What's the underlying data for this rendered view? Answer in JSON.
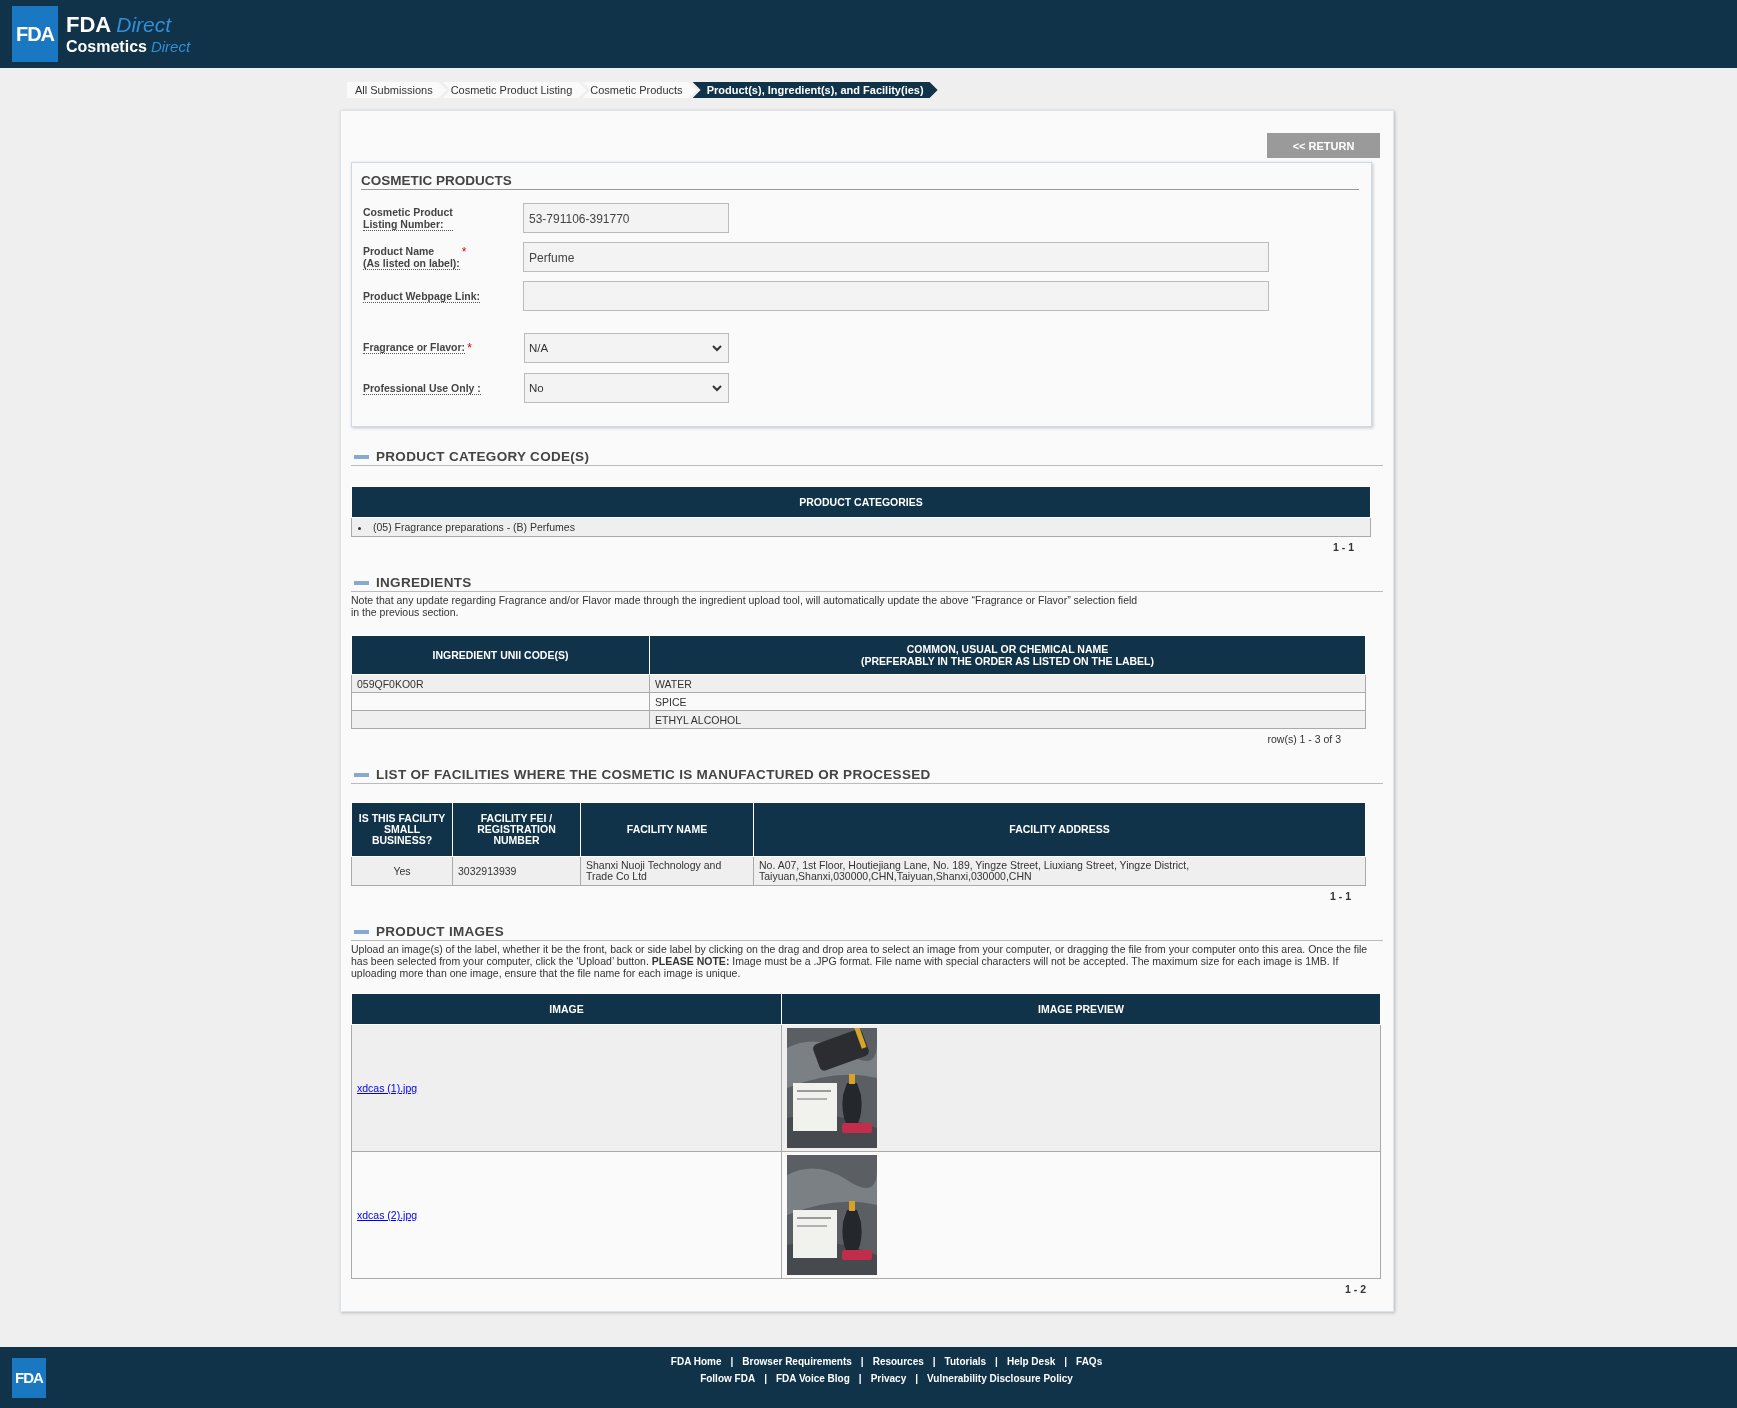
{
  "header": {
    "logo_badge": "FDA",
    "logo_title": "FDA",
    "logo_title_accent": "Direct",
    "logo_subtitle": "Cosmetics",
    "logo_subtitle_accent": "Direct"
  },
  "breadcrumb": [
    {
      "label": "All Submissions",
      "selected": false
    },
    {
      "label": "Cosmetic Product Listing",
      "selected": false
    },
    {
      "label": "Cosmetic Products",
      "selected": false
    },
    {
      "label": "Product(s), Ingredient(s), and Facility(ies)",
      "selected": true
    }
  ],
  "return_button": "<< RETURN",
  "cosmetic_products": {
    "title": "COSMETIC PRODUCTS",
    "fields": [
      {
        "kind": "text",
        "label": "Cosmetic Product\nListing Number:",
        "value": "53-791106-391770"
      },
      {
        "kind": "text",
        "label": "Product Name\n(As listed on label):",
        "required_mark": "*",
        "value": "Perfume"
      },
      {
        "kind": "text",
        "label": "Product Webpage Link:"
      },
      {
        "kind": "select",
        "label": "Fragrance or Flavor:",
        "required_mark": "*",
        "value": "N/A"
      },
      {
        "kind": "select",
        "label": "Professional Use Only :",
        "value": "No"
      }
    ]
  },
  "category_section": {
    "title": "PRODUCT CATEGORY CODE(S)",
    "expanded": true,
    "columns": [
      "PRODUCT CATEGORIES"
    ],
    "items": [
      "(05) Fragrance preparations - (B) Perfumes"
    ],
    "pager": "1 - 1"
  },
  "ingredients_section": {
    "title": "INGREDIENTS",
    "expanded": true,
    "note": "Note that any update regarding Fragrance and/or Flavor made through the ingredient upload tool, will automatically update the above “Fragrance or Flavor” selection field\nin the previous section.",
    "columns": [
      "INGREDIENT UNII CODE(S)",
      "COMMON, USUAL OR CHEMICAL NAME\n(PREFERABLY IN THE ORDER AS LISTED ON THE LABEL)"
    ],
    "rows": [
      {
        "code": "059QF0KO0R",
        "name": "WATER"
      },
      {
        "name": "SPICE"
      },
      {
        "name": "ETHYL ALCOHOL"
      }
    ],
    "pager": "row(s) 1 - 3 of 3"
  },
  "facilities_section": {
    "title": "LIST OF FACILITIES WHERE THE COSMETIC IS MANUFACTURED OR PROCESSED",
    "expanded": true,
    "columns": [
      "IS THIS FACILITY SMALL BUSINESS?",
      "FACILITY FEI / REGISTRATION NUMBER",
      "FACILITY NAME",
      "FACILITY ADDRESS"
    ],
    "rows": [
      {
        "small_business": "Yes",
        "fei": "3032913939",
        "name": "Shanxi Nuoji Technology and Trade Co Ltd",
        "address": "No. A07, 1st Floor, Houtiejiang Lane, No. 189, Yingze Street, Liuxiang Street, Yingze District,\nTaiyuan,Shanxi,030000,CHN,Taiyuan,Shanxi,030000,CHN"
      }
    ],
    "pager": "1 - 1"
  },
  "images_section": {
    "title": "PRODUCT IMAGES",
    "expanded": true,
    "note": "Upload an image(s) of the label, whether it be the front, back or side label by clicking on the drag and drop area to select an image from your computer, or dragging the file from your computer onto this area. Once the file has been selected from your computer, click the ‘Upload’ button. **PLEASE NOTE:** Image must be a .JPG format. File name with special characters will not be accepted. The maximum size for each image is 1MB. If uploading more than one image, ensure that the file name for each image is unique.",
    "columns": [
      "IMAGE",
      "IMAGE PREVIEW"
    ],
    "rows": [
      {
        "file": "xdcas (1).jpg"
      },
      {
        "file": "xdcas (2).jpg"
      }
    ],
    "pager": "1 - 2"
  },
  "footer": {
    "logo_badge": "FDA",
    "links_row_1": [
      "FDA Home",
      "Browser Requirements",
      "Resources",
      "Tutorials",
      "Help Desk",
      "FAQs"
    ],
    "links_row_2": [
      "Follow FDA",
      "FDA Voice Blog",
      "Privacy",
      "Vulnerability Disclosure Policy"
    ],
    "separator": "|"
  }
}
